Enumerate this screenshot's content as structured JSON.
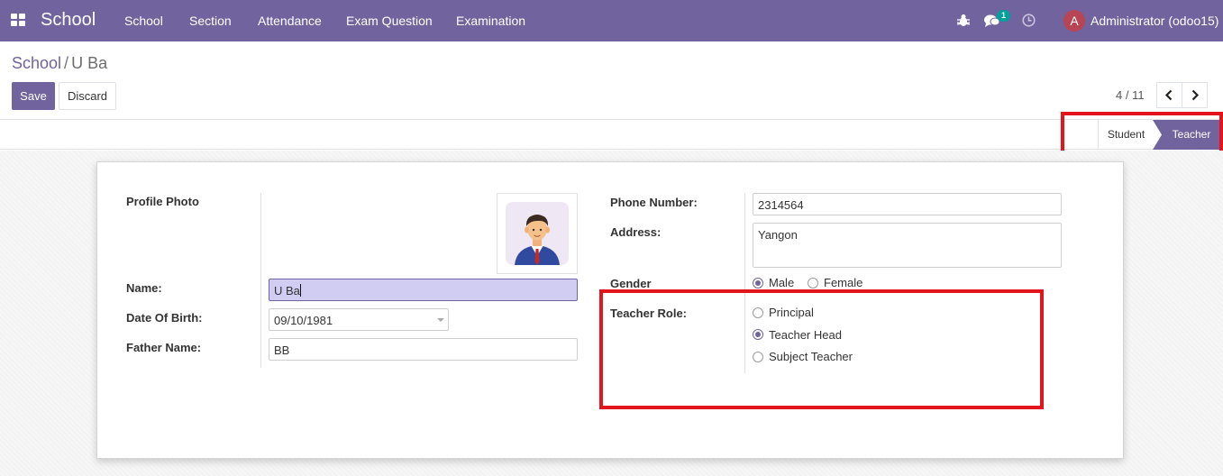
{
  "navbar": {
    "brand": "School",
    "menu": [
      "School",
      "Section",
      "Attendance",
      "Exam Question",
      "Examination"
    ],
    "messages_badge": "1",
    "user_initial": "A",
    "user_name": "Administrator (odoo15)",
    "icons": [
      "apps-grid-icon",
      "bug-icon",
      "chat-icon",
      "clock-icon"
    ]
  },
  "breadcrumb": {
    "parent": "School",
    "separator": "/",
    "current": "U Ba"
  },
  "toolbar": {
    "save_label": "Save",
    "discard_label": "Discard"
  },
  "pager": {
    "text": "4 / 11"
  },
  "statusbar": {
    "stages": [
      "Student",
      "Teacher"
    ],
    "active": "Teacher"
  },
  "form": {
    "profile_photo_label": "Profile Photo",
    "name_label": "Name:",
    "name_value": "U Ba",
    "dob_label": "Date Of Birth:",
    "dob_value": "09/10/1981",
    "father_label": "Father Name:",
    "father_value": "BB",
    "phone_label": "Phone Number:",
    "phone_value": "2314564",
    "address_label": "Address:",
    "address_value": "Yangon",
    "gender_label": "Gender",
    "gender_options": [
      "Male",
      "Female"
    ],
    "gender_selected": "Male",
    "role_label": "Teacher Role:",
    "role_options": [
      "Principal",
      "Teacher Head",
      "Subject Teacher"
    ],
    "role_selected": "Teacher Head"
  },
  "colors": {
    "primary": "#71639e",
    "highlight": "#e3141c",
    "badge": "#00a09d",
    "avatar": "#b84553"
  }
}
